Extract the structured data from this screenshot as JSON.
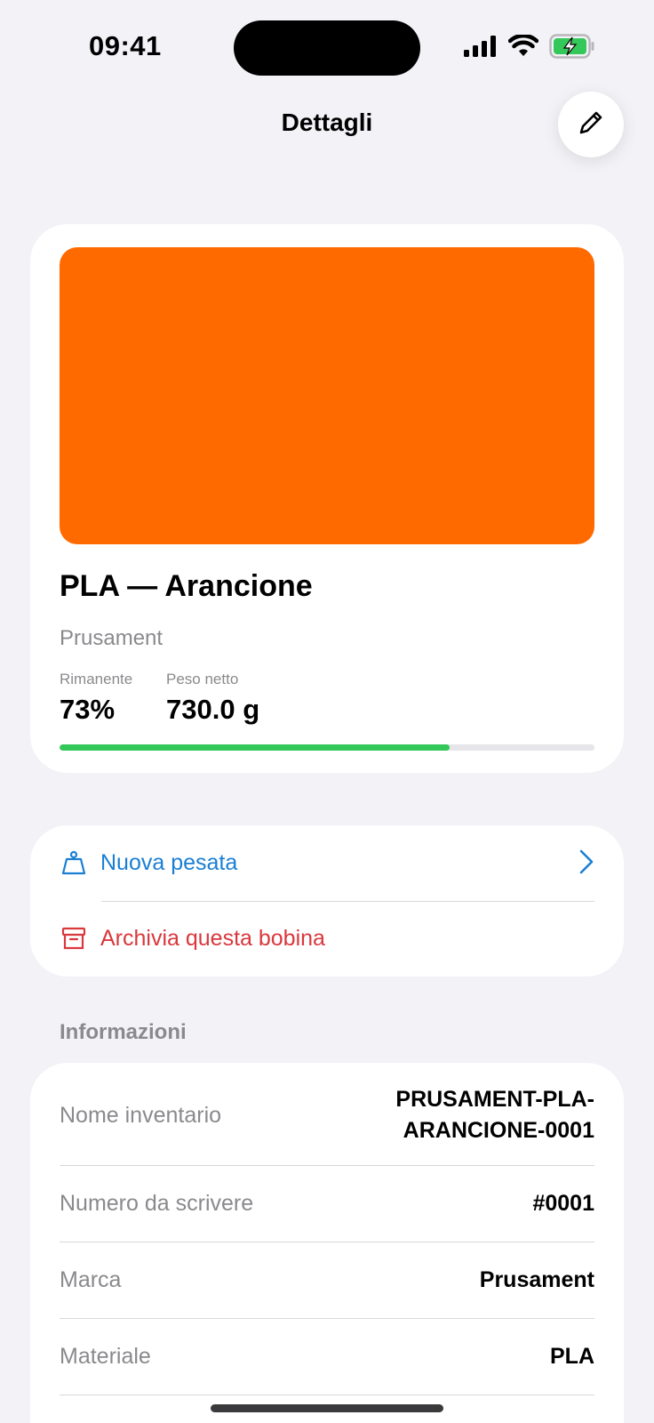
{
  "status_bar": {
    "time": "09:41"
  },
  "nav": {
    "title": "Dettagli",
    "edit_icon": "pencil-icon"
  },
  "spool": {
    "color_hex": "#ff6a00",
    "title": "PLA — Arancione",
    "brand": "Prusament",
    "remaining_label": "Rimanente",
    "remaining_value": "73%",
    "remaining_fraction": 0.73,
    "weight_label": "Peso netto",
    "weight_value": "730.0 g"
  },
  "actions": {
    "new_weighing": "Nuova pesata",
    "archive": "Archivia questa bobina"
  },
  "info": {
    "section_title": "Informazioni",
    "rows": [
      {
        "label": "Nome inventario",
        "value": "PRUSAMENT-PLA-ARANCIONE-0001"
      },
      {
        "label": "Numero da scrivere",
        "value": "#0001"
      },
      {
        "label": "Marca",
        "value": "Prusament"
      },
      {
        "label": "Materiale",
        "value": "PLA"
      }
    ]
  },
  "colors": {
    "accent_blue": "#1a7fd4",
    "destructive_red": "#d9383d",
    "progress_green": "#34c759",
    "background": "#f2f2f7"
  }
}
